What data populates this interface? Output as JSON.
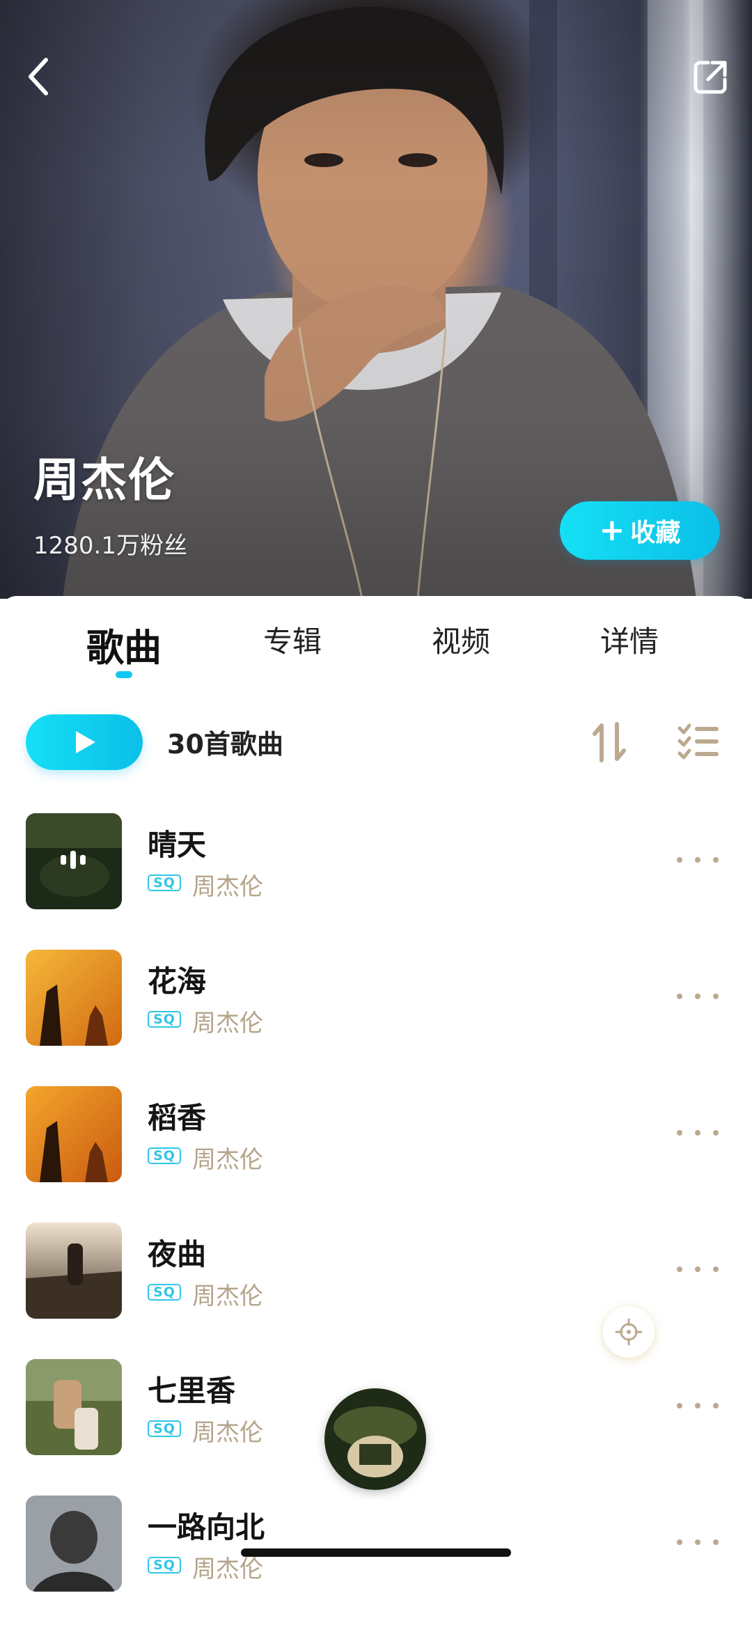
{
  "hero": {
    "artist_name": "周杰伦",
    "fans": "1280.1万粉丝",
    "follow_label": "收藏",
    "follow_plus": "+",
    "back_icon": "chevron-left-icon",
    "share_icon": "share-icon"
  },
  "tabs": [
    {
      "label": "歌曲",
      "active": true
    },
    {
      "label": "专辑",
      "active": false
    },
    {
      "label": "视频",
      "active": false
    },
    {
      "label": "详情",
      "active": false
    }
  ],
  "toolbar": {
    "song_count": "30首歌曲",
    "play_icon": "play-icon",
    "sort_icon": "sort-icon",
    "multi_select_icon": "multi-select-icon"
  },
  "songs": [
    {
      "title": "晴天",
      "badge": "SQ",
      "artist": "周杰伦"
    },
    {
      "title": "花海",
      "badge": "SQ",
      "artist": "周杰伦"
    },
    {
      "title": "稻香",
      "badge": "SQ",
      "artist": "周杰伦"
    },
    {
      "title": "夜曲",
      "badge": "SQ",
      "artist": "周杰伦"
    },
    {
      "title": "七里香",
      "badge": "SQ",
      "artist": "周杰伦"
    },
    {
      "title": "一路向北",
      "badge": "SQ",
      "artist": "周杰伦"
    }
  ],
  "colors": {
    "accent": "#12c7ef",
    "artist_text": "#b5a48a"
  }
}
